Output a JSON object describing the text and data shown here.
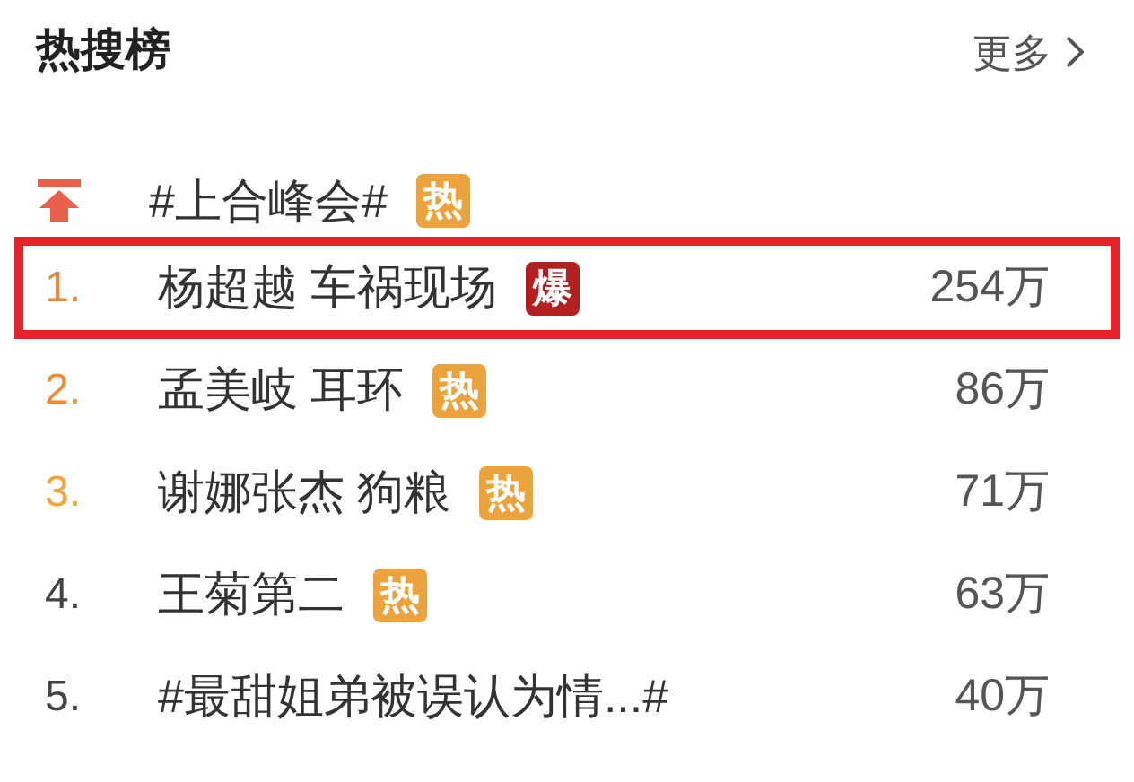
{
  "header": {
    "title": "热搜榜",
    "more": "更多"
  },
  "pinned": {
    "topic": "#上合峰会#",
    "badge": {
      "text": "热",
      "kind": "hot"
    }
  },
  "items": [
    {
      "rank": "1.",
      "color": "#e0873f",
      "topic": "杨超越 车祸现场",
      "badge": {
        "text": "爆",
        "kind": "boom"
      },
      "count": "254万",
      "highlighted": true
    },
    {
      "rank": "2.",
      "color": "#f08c2e",
      "topic": "孟美岐 耳环",
      "badge": {
        "text": "热",
        "kind": "hot"
      },
      "count": "86万",
      "highlighted": false
    },
    {
      "rank": "3.",
      "color": "#f2a33a",
      "topic": "谢娜张杰 狗粮",
      "badge": {
        "text": "热",
        "kind": "hot"
      },
      "count": "71万",
      "highlighted": false
    },
    {
      "rank": "4.",
      "color": "#444444",
      "topic": "王菊第二",
      "badge": {
        "text": "热",
        "kind": "hot"
      },
      "count": "63万",
      "highlighted": false
    },
    {
      "rank": "5.",
      "color": "#444444",
      "topic": "#最甜姐弟被误认为情...#",
      "count": "40万",
      "highlighted": false
    }
  ]
}
